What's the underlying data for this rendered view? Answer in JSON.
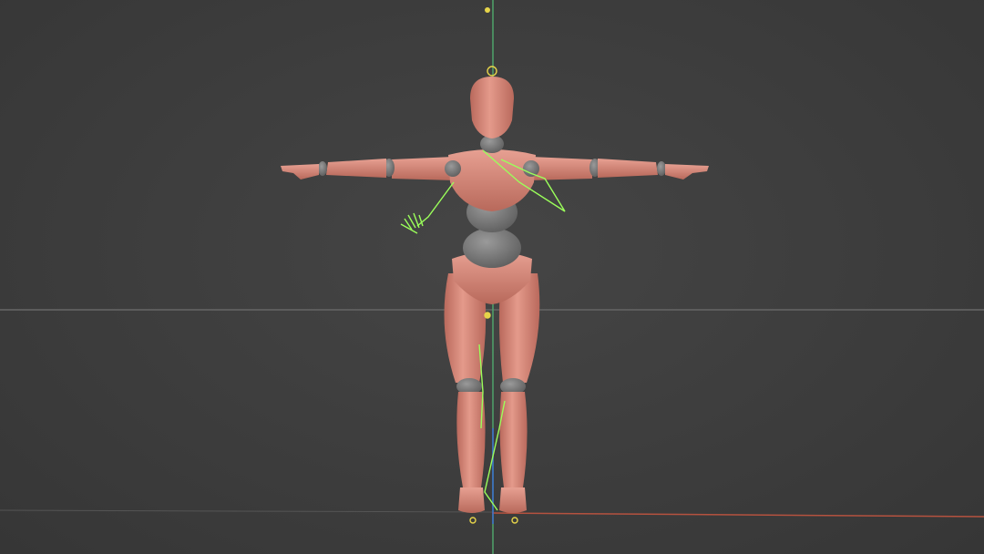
{
  "viewport": {
    "mode": "3d-perspective",
    "background_color": "#3d3d3d",
    "horizon_color": "#5a5a5a",
    "y_axis_color": "#4fa36a",
    "x_axis_color": "#b5523f",
    "z_axis_color": "#3b6fd1"
  },
  "figure": {
    "type": "rigged-humanoid-mannequin",
    "pose": "T-pose",
    "skin_color": "#d98a7c",
    "skin_shadow_color": "#b66a5e",
    "joint_color": "#8a8a8a",
    "bone_overlay_color": "#9bff5a",
    "ik_handle_color": "#e6d44a"
  }
}
